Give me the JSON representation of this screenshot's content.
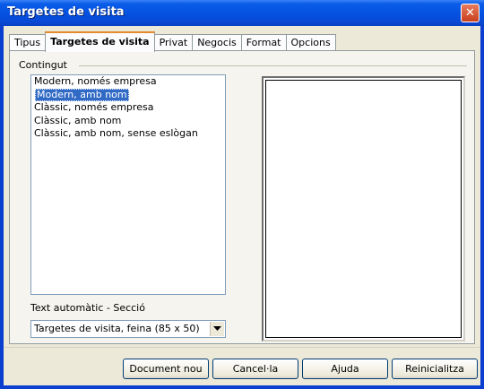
{
  "window": {
    "title": "Targetes de visita",
    "close_glyph": "✕"
  },
  "tabs": [
    {
      "label": "Tipus"
    },
    {
      "label": "Targetes de visita",
      "active": true
    },
    {
      "label": "Privat"
    },
    {
      "label": "Negocis"
    },
    {
      "label": "Format"
    },
    {
      "label": "Opcions"
    }
  ],
  "content": {
    "group_label": "Contingut",
    "list_items": [
      "Modern, només empresa",
      "Modern, amb nom",
      "Clàssic, només empresa",
      "Clàssic, amb nom",
      "Clàssic, amb nom, sense eslògan"
    ],
    "selected_index": 1,
    "autotext_label": "Text automàtic - Secció",
    "autotext_value": "Targetes de visita, feina (85 x 50)"
  },
  "buttons": {
    "new_document": "Document nou",
    "cancel": "Cancel·la",
    "help": "Ajuda",
    "reset": "Reinicialitza"
  },
  "icons": {
    "combo_arrow": "chevron-down-icon",
    "close": "close-icon"
  }
}
